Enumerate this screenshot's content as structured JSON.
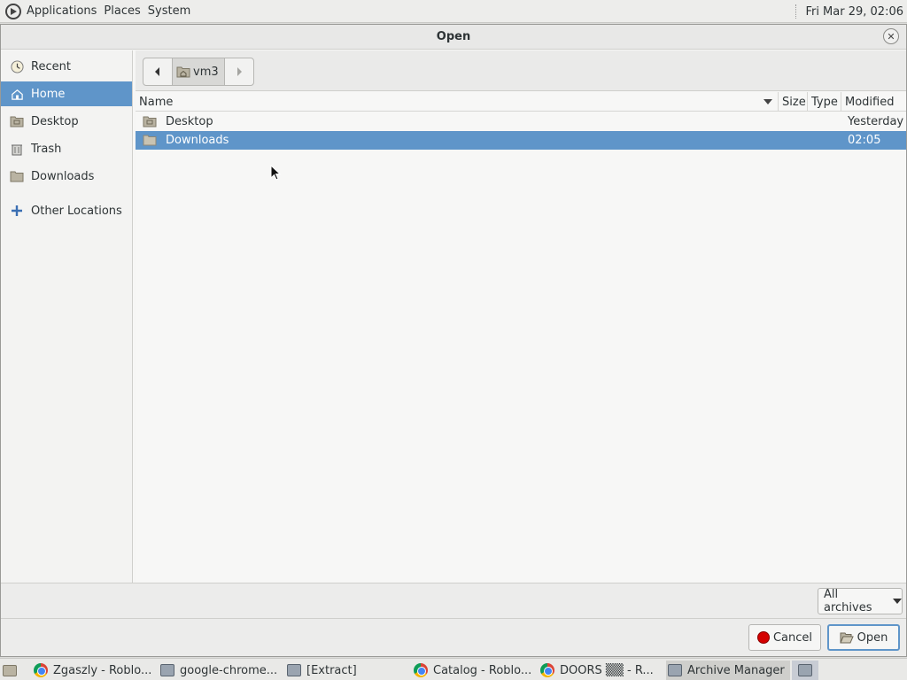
{
  "top_panel": {
    "menus": [
      "Applications",
      "Places",
      "System"
    ],
    "clock": "Fri Mar 29, 02:06"
  },
  "dialog": {
    "title": "Open",
    "sidebar": [
      {
        "label": "Recent",
        "icon": "clock-icon"
      },
      {
        "label": "Home",
        "icon": "home-icon",
        "selected": true
      },
      {
        "label": "Desktop",
        "icon": "desktop-folder-icon"
      },
      {
        "label": "Trash",
        "icon": "trash-icon"
      },
      {
        "label": "Downloads",
        "icon": "folder-icon"
      },
      {
        "label": "Other Locations",
        "icon": "plus-icon"
      }
    ],
    "path": {
      "current": "vm3"
    },
    "columns": {
      "name": "Name",
      "size": "Size",
      "type": "Type",
      "modified": "Modified"
    },
    "files": [
      {
        "name": "Desktop",
        "modified": "Yesterday"
      },
      {
        "name": "Downloads",
        "modified": "02:05",
        "selected": true
      }
    ],
    "filter": {
      "selected": "All archives"
    },
    "buttons": {
      "cancel": "Cancel",
      "open": "Open"
    }
  },
  "taskbar": {
    "items": [
      {
        "label": "Zgaszly - Roblo...",
        "icon": "chrome-icon"
      },
      {
        "label": "google-chrome...",
        "icon": "archive-icon"
      },
      {
        "label": "[Extract]",
        "icon": "archive-icon"
      },
      {
        "label": "Catalog - Roblo...",
        "icon": "chrome-icon"
      },
      {
        "label": "DOORS ▒▒ - R...",
        "icon": "chrome-icon"
      },
      {
        "label": "Archive Manager",
        "icon": "archive-icon"
      }
    ]
  },
  "colors": {
    "selection": "#5f95c9",
    "stop": "#d40000"
  }
}
